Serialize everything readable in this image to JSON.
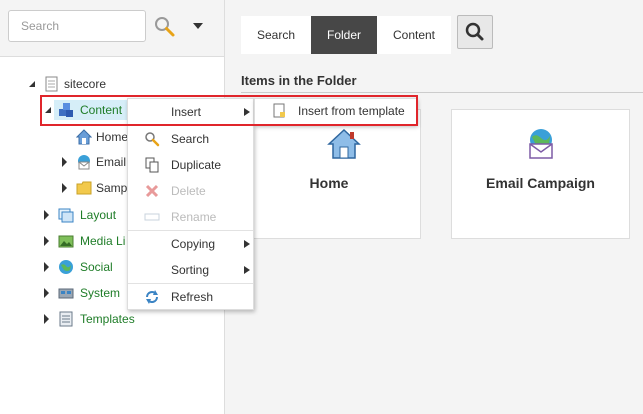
{
  "search": {
    "placeholder": "Search"
  },
  "tree": {
    "root": "sitecore",
    "content": "Content",
    "home": "Home",
    "email": "Email",
    "sample": "Samp",
    "layout": "Layout",
    "media": "Media Li",
    "social": "Social",
    "system": "System",
    "templates": "Templates"
  },
  "tabs": [
    {
      "label": "Search"
    },
    {
      "label": "Folder"
    },
    {
      "label": "Content"
    }
  ],
  "active_tab": "Folder",
  "section_title": "Items in the Folder",
  "cards": [
    {
      "label": "Home",
      "icon": "home-icon"
    },
    {
      "label": "Email Campaign",
      "icon": "email-campaign-icon"
    }
  ],
  "context_menu": {
    "insert": "Insert",
    "search": "Search",
    "duplicate": "Duplicate",
    "delete": "Delete",
    "rename": "Rename",
    "copying": "Copying",
    "sorting": "Sorting",
    "refresh": "Refresh"
  },
  "submenu": {
    "insert_from_template": "Insert from template"
  },
  "colors": {
    "tree_text": "#1f7d28",
    "active_tab": "#474747",
    "highlight": "#e0252b"
  }
}
